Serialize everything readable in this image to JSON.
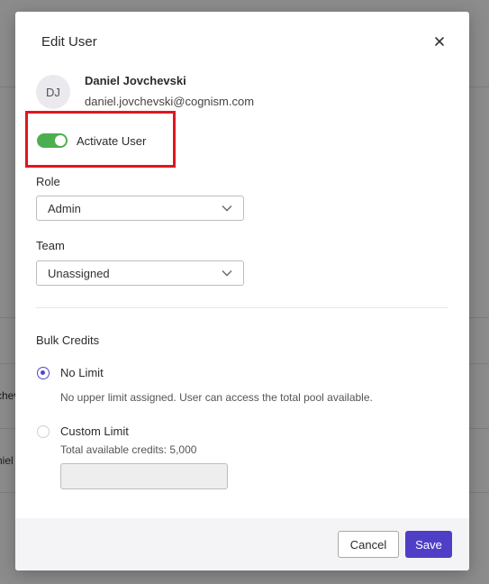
{
  "background": {
    "row_fragments": [
      "chevski",
      "niel"
    ]
  },
  "modal": {
    "title": "Edit User",
    "close_icon": "close-icon",
    "user": {
      "initials": "DJ",
      "name": "Daniel Jovchevski",
      "email": "daniel.jovchevski@cognism.com"
    },
    "activate_toggle": {
      "label": "Activate User",
      "on": true,
      "color": "#4caf4f"
    },
    "role": {
      "label": "Role",
      "value": "Admin"
    },
    "team": {
      "label": "Team",
      "value": "Unassigned"
    },
    "bulk_credits": {
      "title": "Bulk Credits",
      "no_limit": {
        "label": "No Limit",
        "description": "No upper limit assigned. User can access the total pool available.",
        "selected": true
      },
      "custom_limit": {
        "label": "Custom Limit",
        "description": "Total available credits: 5,000",
        "selected": false,
        "value": ""
      }
    },
    "buttons": {
      "cancel": "Cancel",
      "save": "Save"
    },
    "colors": {
      "accent": "#4f3fc6",
      "highlight": "#e0161f"
    }
  }
}
